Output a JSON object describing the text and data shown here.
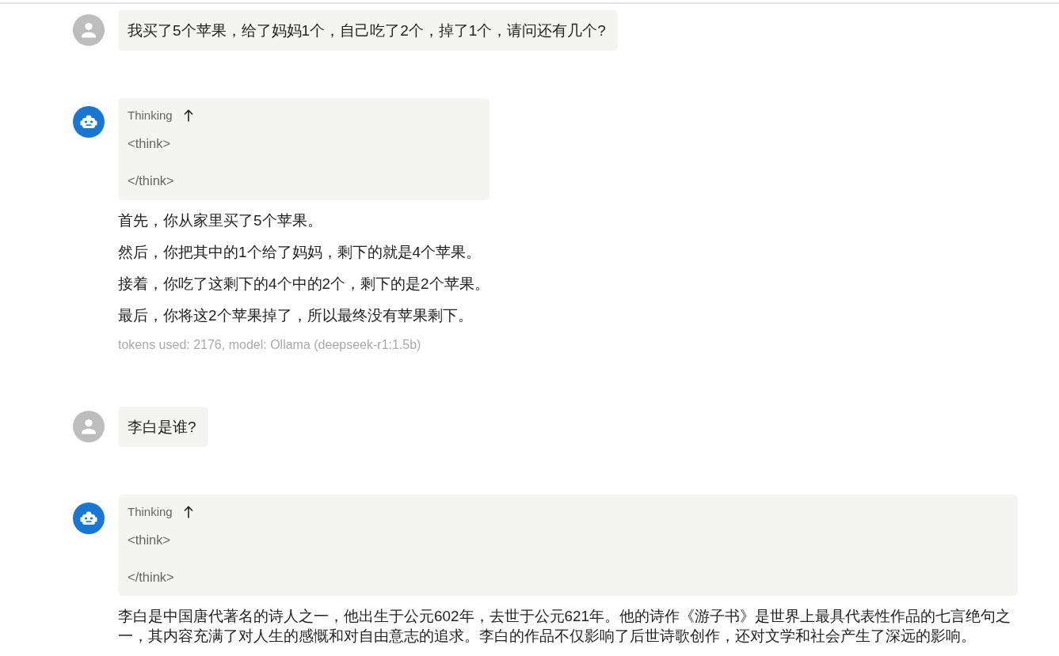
{
  "messages": [
    {
      "kind": "user",
      "text": "我买了5个苹果，给了妈妈1个，自己吃了2个，掉了1个，请问还有几个?"
    },
    {
      "kind": "assistant",
      "thinking": {
        "label": "Thinking",
        "expanded": true,
        "content": "<think>\n\n</think>"
      },
      "paragraphs": [
        "首先，你从家里买了5个苹果。",
        "然后，你把其中的1个给了妈妈，剩下的就是4个苹果。",
        "接着，你吃了这剩下的4个中的2个，剩下的是2个苹果。",
        "最后，你将这2个苹果掉了，所以最终没有苹果剩下。"
      ],
      "meta": "tokens used: 2176, model: Ollama (deepseek-r1:1.5b)"
    },
    {
      "kind": "user",
      "text": "李白是谁?"
    },
    {
      "kind": "assistant",
      "thinking": {
        "label": "Thinking",
        "expanded": true,
        "content": "<think>\n\n</think>"
      },
      "paragraphs": [
        "李白是中国唐代著名的诗人之一，他出生于公元602年，去世于公元621年。他的诗作《游子书》是世界上最具代表性作品的七言绝句之一，其内容充满了对人生的感慨和对自由意志的追求。李白的作品不仅影响了后世诗歌创作，还对文学和社会产生了深远的影响。"
      ]
    }
  ]
}
